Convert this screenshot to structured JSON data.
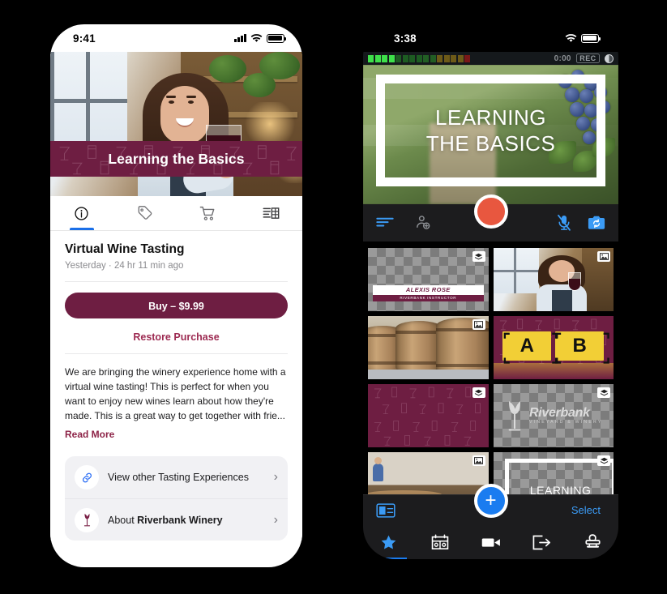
{
  "left_phone": {
    "status_bar": {
      "time": "9:41",
      "signal_icon": "cellular-bars-icon",
      "wifi_icon": "wifi-icon",
      "battery_icon": "battery-icon"
    },
    "hero": {
      "banner_title": "Learning the Basics",
      "image_alt": "wine-taster-photo"
    },
    "tabs": [
      {
        "name": "tab-info",
        "icon": "info-circle-icon",
        "active": true
      },
      {
        "name": "tab-tag",
        "icon": "tag-icon",
        "active": false
      },
      {
        "name": "tab-cart",
        "icon": "shopping-cart-icon",
        "active": false
      },
      {
        "name": "tab-media",
        "icon": "media-list-icon",
        "active": false
      }
    ],
    "content": {
      "title": "Virtual Wine Tasting",
      "meta": "Yesterday  ·  24 hr 11 min ago",
      "buy_button": "Buy – $9.99",
      "restore_link": "Restore Purchase",
      "description": "We are bringing the winery experience home with a virtual wine tasting! This is perfect for when you want to enjoy new wines learn about how they're made. This is a great way to get together with frie...",
      "read_more": "Read More"
    },
    "link_rows": [
      {
        "icon": "link-icon",
        "label": "View other Tasting Experiences",
        "chevron": "›"
      },
      {
        "icon": "wine-glass-icon",
        "label_prefix": "About ",
        "label_bold": "Riverbank Winery",
        "chevron": "›"
      }
    ]
  },
  "right_phone": {
    "status_bar": {
      "time": "3:38",
      "wifi_icon": "wifi-icon",
      "battery_icon": "battery-icon"
    },
    "meter_bar": {
      "timecode": "0:00",
      "rec_badge": "REC",
      "half_icon": "half-circle-icon"
    },
    "viewport": {
      "slide_line1": "LEARNING",
      "slide_line2": "THE BASICS",
      "background_alt": "vineyard-grapes-photo"
    },
    "capture_controls": [
      {
        "name": "teleprompter-lines-icon",
        "color": "#3b9bf5"
      },
      {
        "name": "add-presenter-icon",
        "color": "#8e9196"
      },
      {
        "name": "record-button",
        "color": "#e8573f"
      },
      {
        "name": "mic-muted-icon",
        "color": "#3b9bf5"
      },
      {
        "name": "camera-flip-icon",
        "color": "#3b9bf5"
      }
    ],
    "thumbnails": [
      {
        "name": "thumb-alexis-rose-lower-third",
        "badge": "layers-icon",
        "kind": "lower-third",
        "name_text": "ALEXIS ROSE",
        "role_text": "RIVERBANK INSTRUCTOR",
        "selected": false
      },
      {
        "name": "thumb-taster-photo",
        "badge": "image-icon",
        "kind": "photo-taster",
        "selected": false
      },
      {
        "name": "thumb-barrels-photo",
        "badge": "image-icon",
        "kind": "photo-barrels",
        "selected": false
      },
      {
        "name": "thumb-ab-cards",
        "badge": "",
        "kind": "ab-cards",
        "a_label": "A",
        "b_label": "B",
        "selected": false
      },
      {
        "name": "thumb-maroon-pattern",
        "badge": "layers-icon",
        "kind": "pattern",
        "selected": false
      },
      {
        "name": "thumb-riverbank-logo",
        "badge": "layers-icon",
        "kind": "logo",
        "logo_text": "Riverbank",
        "logo_sub": "VINEYARD & WINERY",
        "selected": false
      },
      {
        "name": "thumb-tasting-room-photo",
        "badge": "image-icon",
        "kind": "photo-room",
        "selected": false
      },
      {
        "name": "thumb-learning-title",
        "badge": "layers-icon",
        "kind": "title-card",
        "title_text": "LEARNING",
        "selected": true
      }
    ],
    "lower_bar": {
      "layout_icon": "split-layout-icon",
      "add_button": "+",
      "select_label": "Select"
    },
    "tab_bar": [
      {
        "name": "tab-favorites",
        "icon": "star-icon",
        "active": true
      },
      {
        "name": "tab-scoreboard",
        "icon": "scoreboard-icon",
        "active": false
      },
      {
        "name": "tab-video",
        "icon": "video-camera-icon",
        "active": false
      },
      {
        "name": "tab-export",
        "icon": "export-icon",
        "active": false
      },
      {
        "name": "tab-stamp",
        "icon": "stamp-icon",
        "active": false
      }
    ]
  },
  "colors": {
    "brand_maroon": "#6e1e42",
    "accent_blue": "#1a7cf0",
    "record_red": "#e8573f",
    "card_yellow": "#f2cf36"
  }
}
